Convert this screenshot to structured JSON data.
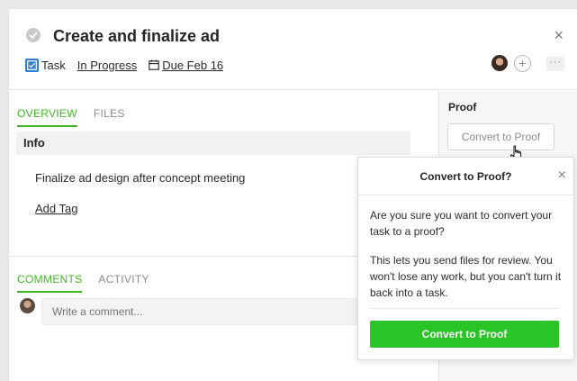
{
  "task": {
    "title": "Create and finalize ad",
    "type_label": "Task",
    "status": "In Progress",
    "due": "Due Feb 16"
  },
  "header": {
    "close_glyph": "×",
    "add_member_glyph": "+",
    "more_glyph": "···"
  },
  "overview_tabs": [
    {
      "label": "OVERVIEW",
      "active": true
    },
    {
      "label": "FILES",
      "active": false
    }
  ],
  "info": {
    "heading": "Info",
    "description": "Finalize ad design after concept meeting",
    "add_tag": "Add Tag"
  },
  "activity_tabs": [
    {
      "label": "COMMENTS",
      "active": true
    },
    {
      "label": "ACTIVITY",
      "active": false
    }
  ],
  "comment": {
    "placeholder": "Write a comment..."
  },
  "proof": {
    "label": "Proof",
    "convert_button": "Convert to Proof"
  },
  "popover": {
    "title": "Convert to Proof?",
    "close_glyph": "×",
    "question": "Are you sure you want to convert your task to a proof?",
    "explanation": "This lets you send files for review. You won't lose any work, but you can't turn it back into a task.",
    "confirm_button": "Convert to Proof"
  },
  "colors": {
    "accent_green": "#3fb823",
    "confirm_green": "#2bc427",
    "task_blue": "#2f7fd3"
  },
  "icons": {
    "complete": "checkmark-circle-icon",
    "task_type": "checkbox-icon",
    "calendar": "calendar-icon",
    "cursor": "hand-pointer-icon"
  }
}
